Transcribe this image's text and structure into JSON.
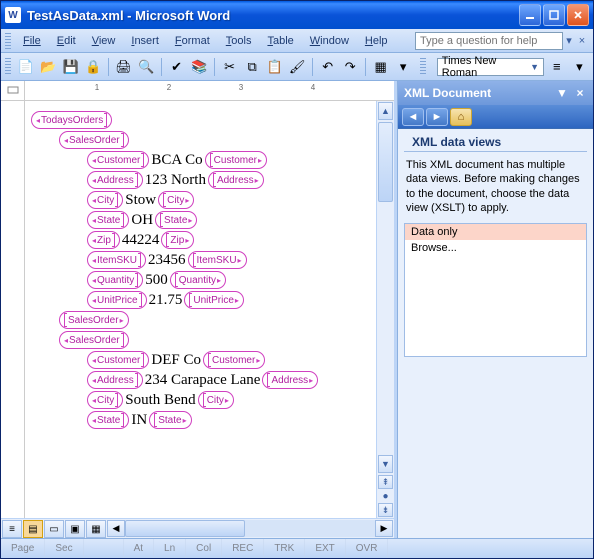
{
  "window": {
    "title": "TestAsData.xml - Microsoft Word"
  },
  "menu": {
    "items": [
      "File",
      "Edit",
      "View",
      "Insert",
      "Format",
      "Tools",
      "Table",
      "Window",
      "Help"
    ],
    "question_placeholder": "Type a question for help"
  },
  "toolbar": {
    "font_name": "Times New Roman"
  },
  "task_pane": {
    "title": "XML Document",
    "section_title": "XML data views",
    "description": "This XML document has multiple data views. Before making changes to the document, choose the data view (XSLT) to apply.",
    "options": [
      "Data only",
      "Browse..."
    ],
    "selected": 0
  },
  "statusbar": {
    "cells": [
      "Page",
      "Sec",
      "",
      "At",
      "Ln",
      "Col",
      "REC",
      "TRK",
      "EXT",
      "OVR",
      ""
    ]
  },
  "doc": {
    "root": "TodaysOrders",
    "order1": {
      "tag": "SalesOrder",
      "customer_tag": "Customer",
      "customer": "BCA Co",
      "address_tag": "Address",
      "address": "123 North",
      "city_tag": "City",
      "city": "Stow",
      "state_tag": "State",
      "state": "OH",
      "zip_tag": "Zip",
      "zip": "44224",
      "sku_tag": "ItemSKU",
      "sku": "23456",
      "qty_tag": "Quantity",
      "qty": "500",
      "price_tag": "UnitPrice",
      "price": "21.75"
    },
    "order2": {
      "tag": "SalesOrder",
      "customer_tag": "Customer",
      "customer": "DEF Co",
      "address_tag": "Address",
      "address": "234 Carapace Lane",
      "city_tag": "City",
      "city": "South Bend",
      "state_tag": "State",
      "state": "IN"
    }
  }
}
